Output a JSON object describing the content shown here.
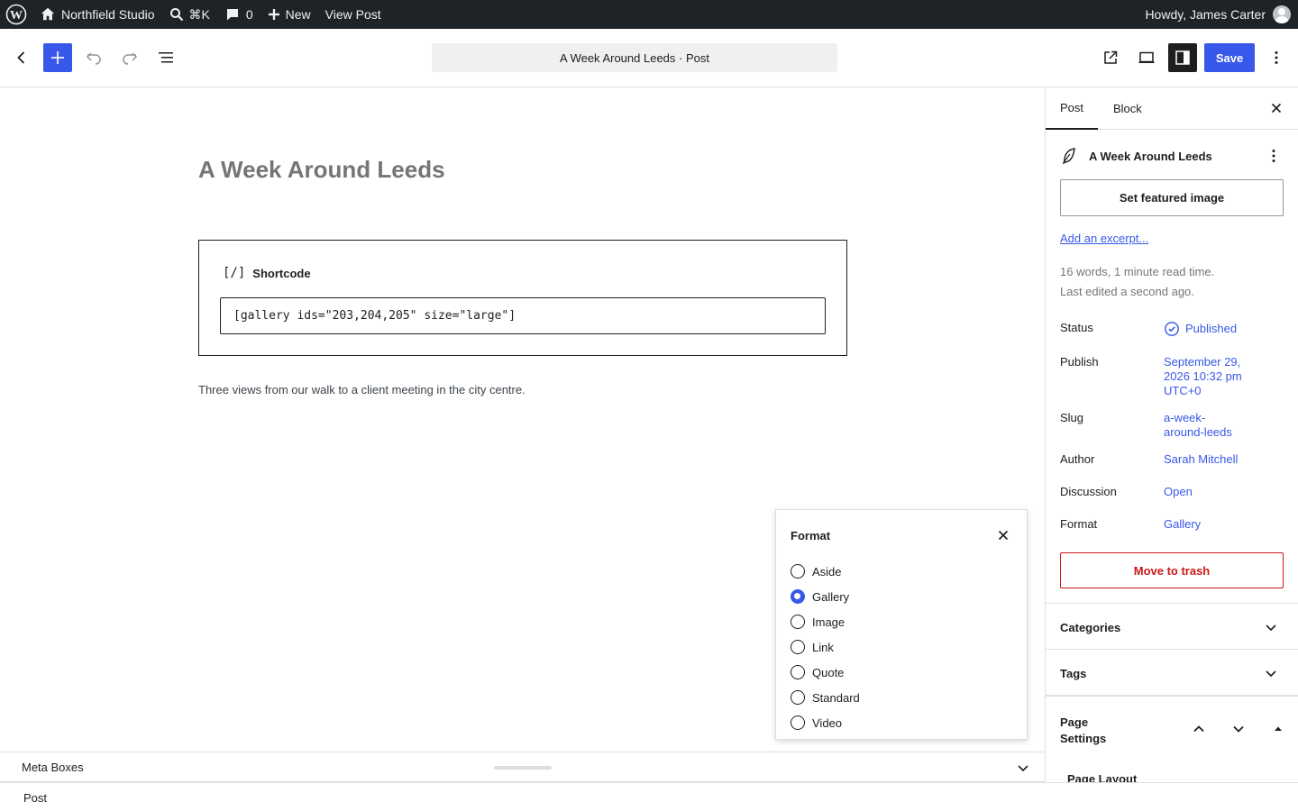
{
  "adminbar": {
    "site_name": "Northfield Studio",
    "shortcut": "⌘K",
    "comments_count": "0",
    "new_label": "New",
    "view_post": "View Post",
    "howdy": "Howdy, James Carter"
  },
  "header": {
    "document_title": "A Week Around Leeds · Post",
    "save_label": "Save"
  },
  "canvas": {
    "post_title": "A Week Around Leeds",
    "shortcode_label": "Shortcode",
    "shortcode_glyph": "[/]",
    "shortcode_value": "[gallery ids=\"203,204,205\" size=\"large\"]",
    "caption": "Three views from our walk to a client meeting in the city centre."
  },
  "format_popover": {
    "title": "Format",
    "options": [
      "Aside",
      "Gallery",
      "Image",
      "Link",
      "Quote",
      "Standard",
      "Video"
    ],
    "selected": "Gallery"
  },
  "metaboxes": {
    "title": "Meta Boxes"
  },
  "footer": {
    "breadcrumb": "Post"
  },
  "sidebar": {
    "tabs": [
      "Post",
      "Block"
    ],
    "post_name": "A Week Around Leeds",
    "featured_image": "Set featured image",
    "excerpt_link": "Add an excerpt...",
    "word_count": "16 words, 1 minute read time.",
    "last_edited": "Last edited a second ago.",
    "rows": {
      "status": {
        "label": "Status",
        "value": "Published"
      },
      "publish": {
        "label": "Publish",
        "value": "September 29, 2026 10:32 pm UTC+0"
      },
      "slug": {
        "label": "Slug",
        "value": "a-week-around-leeds"
      },
      "author": {
        "label": "Author",
        "value": "Sarah Mitchell"
      },
      "discussion": {
        "label": "Discussion",
        "value": "Open"
      },
      "format": {
        "label": "Format",
        "value": "Gallery"
      }
    },
    "trash": "Move to trash",
    "panels": {
      "categories": "Categories",
      "tags": "Tags",
      "page_settings": "Page Settings",
      "page_layout": "Page Layout"
    }
  },
  "colors": {
    "accent": "#3858e9",
    "destructive": "#cc1818",
    "adminbar": "#1d2327"
  }
}
